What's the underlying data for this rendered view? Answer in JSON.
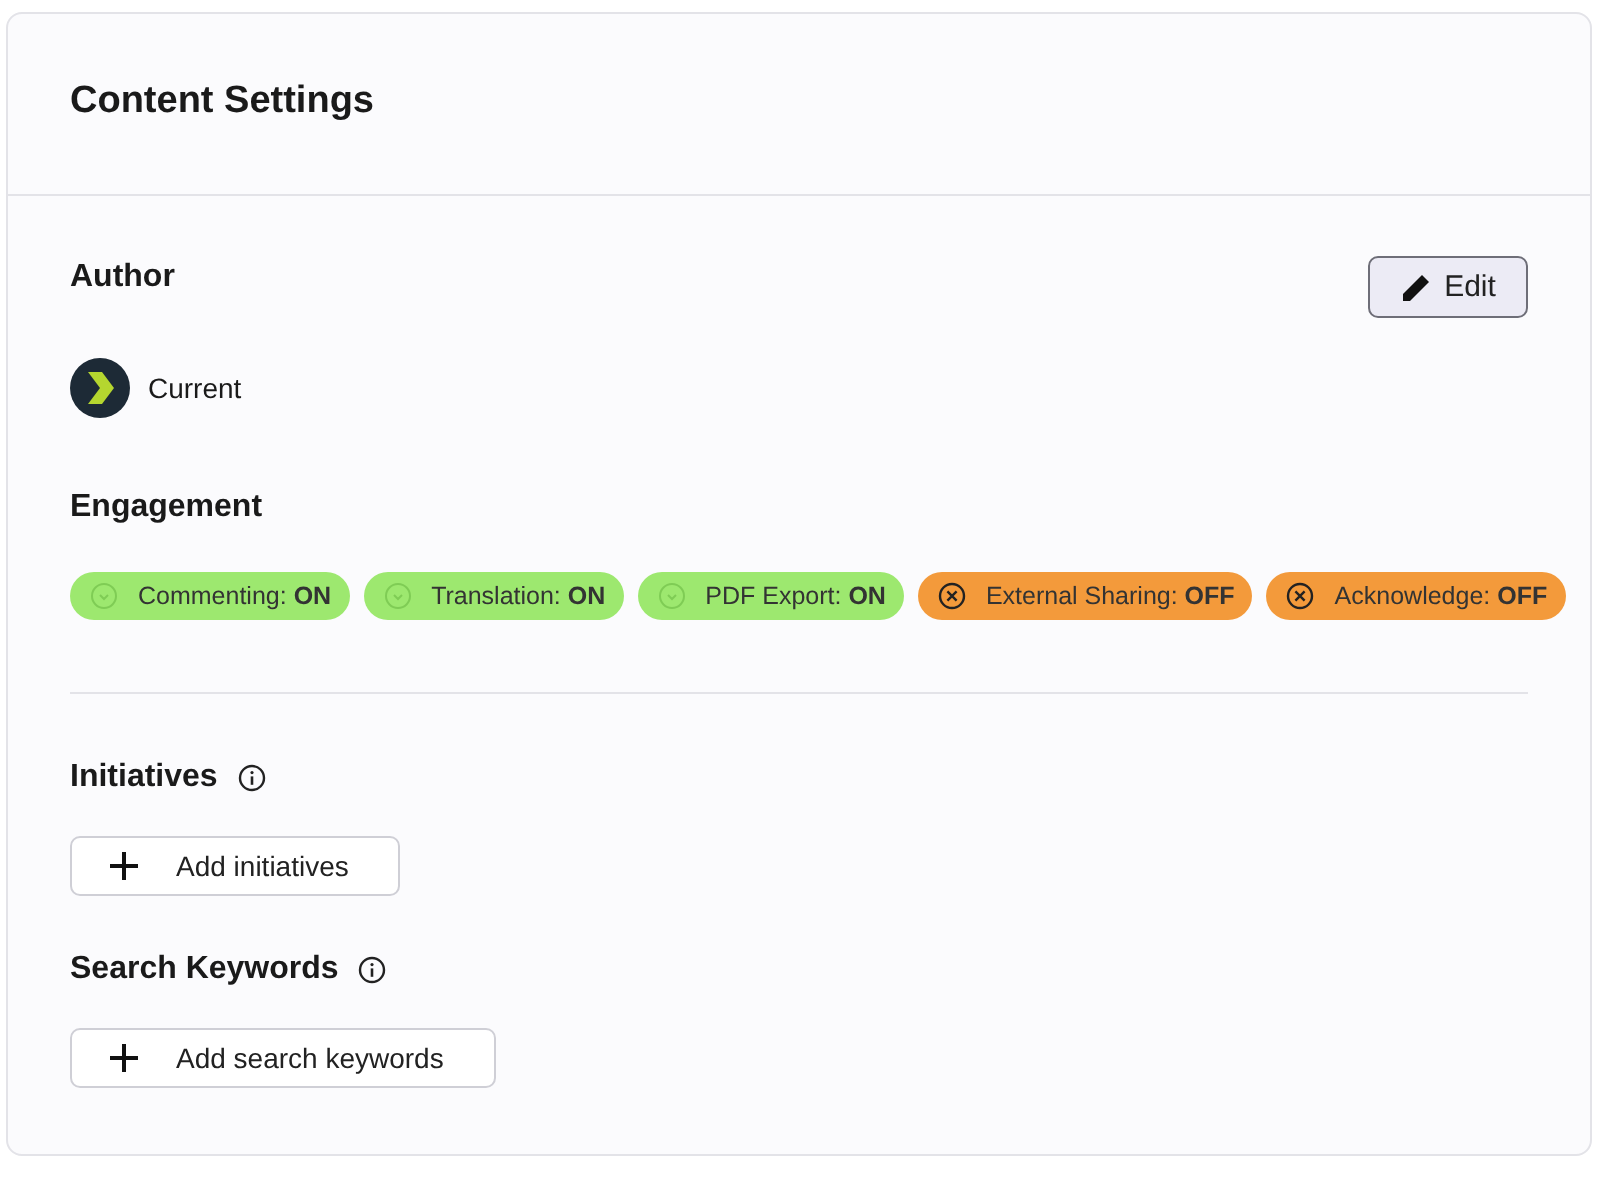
{
  "title": "Content Settings",
  "author": {
    "heading": "Author",
    "name": "Current",
    "edit_button": "Edit"
  },
  "engagement": {
    "heading": "Engagement",
    "chips": [
      {
        "text": "Commenting: **ON**",
        "on": true
      },
      {
        "text": "Translation: **ON**",
        "on": true
      },
      {
        "text": "PDF Export: **ON**",
        "on": true
      },
      {
        "text": "External Sharing: **OFF**",
        "on": false
      },
      {
        "text": "Acknowledge: **OFF**",
        "on": false
      }
    ]
  },
  "sections": [
    {
      "heading": "Initiatives",
      "button": "Add initiatives"
    },
    {
      "heading": "Search Keywords",
      "button": "Add search keywords"
    }
  ]
}
